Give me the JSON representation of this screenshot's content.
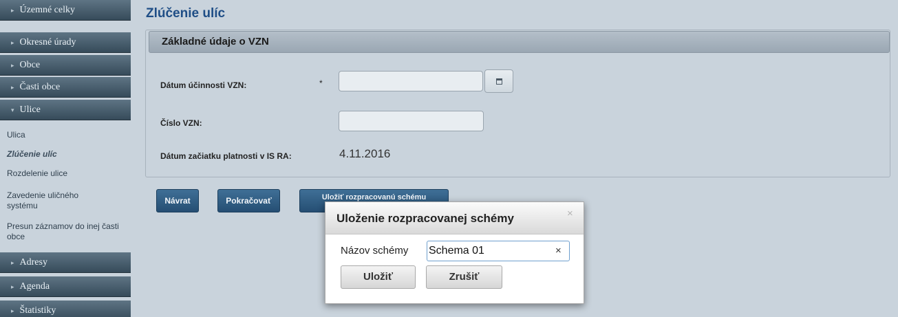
{
  "sidebar": {
    "sections": [
      {
        "label": "Územné celky",
        "expanded": false
      },
      {
        "label": "Okresné úrady",
        "expanded": false
      },
      {
        "label": "Obce",
        "expanded": false
      },
      {
        "label": "Časti obce",
        "expanded": false
      },
      {
        "label": "Ulice",
        "expanded": true
      },
      {
        "label": "Adresy",
        "expanded": false
      },
      {
        "label": "Agenda",
        "expanded": false
      },
      {
        "label": "Štatistiky",
        "expanded": false
      }
    ],
    "ulice_items": [
      {
        "label": "Ulica",
        "active": false
      },
      {
        "label": "Zlúčenie ulíc",
        "active": true
      },
      {
        "label": "Rozdelenie ulice",
        "active": false
      },
      {
        "label": "Zavedenie uličného systému",
        "active": false
      },
      {
        "label": "Presun záznamov do inej časti obce",
        "active": false
      }
    ]
  },
  "page": {
    "title": "Zlúčenie ulíc"
  },
  "panel": {
    "header": "Základné údaje o VZN",
    "effective_date_label": "Dátum účinnosti VZN:",
    "required_mark": "*",
    "effective_date_value": "",
    "vzn_number_label": "Číslo VZN:",
    "vzn_number_value": "",
    "start_date_label": "Dátum začiatku platnosti v IS RA:",
    "start_date_value": "4.11.2016"
  },
  "actions": {
    "back_label": "Návrat",
    "continue_label": "Pokračovať",
    "save_draft_label": "Uložiť rozpracovanú schému"
  },
  "modal": {
    "title": "Uloženie rozpracovanej schémy",
    "close_glyph": "×",
    "scheme_label": "Názov schémy",
    "scheme_value": "Schema 01",
    "clear_glyph": "×",
    "save_label": "Uložiť",
    "cancel_label": "Zrušiť"
  },
  "icons": {
    "collapsed_arrow": "▸",
    "expanded_arrow": "▾",
    "calendar": "calendar-icon"
  },
  "colors": {
    "sidebar_header": "#455b6a",
    "primary_button": "#2f5b82",
    "title": "#1f4e86",
    "background": "#c9d3dc"
  }
}
